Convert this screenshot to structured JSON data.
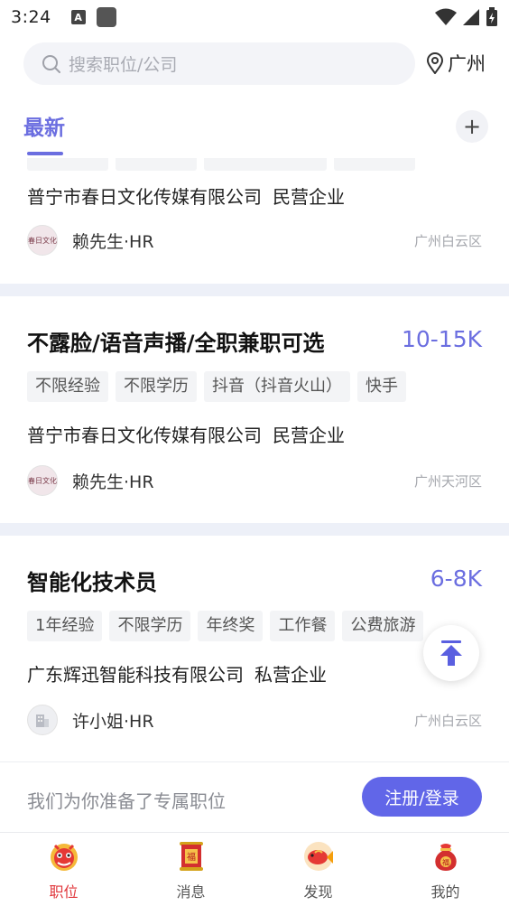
{
  "status_bar": {
    "time": "3:24",
    "a_icon_glyph": "A"
  },
  "search": {
    "placeholder": "搜索职位/公司",
    "location": "广州"
  },
  "tabs": {
    "latest": "最新"
  },
  "jobs": [
    {
      "title": "",
      "salary": "",
      "tags": [],
      "company": "普宁市春日文化传媒有限公司",
      "company_type": "民营企业",
      "hr": "赖先生·HR",
      "district": "广州白云区",
      "avatar_text": "春日文化"
    },
    {
      "title": "不露脸/语音声播/全职兼职可选",
      "salary": "10-15K",
      "tags": [
        "不限经验",
        "不限学历",
        "抖音（抖音火山）",
        "快手"
      ],
      "company": "普宁市春日文化传媒有限公司",
      "company_type": "民营企业",
      "hr": "赖先生·HR",
      "district": "广州天河区",
      "avatar_text": "春日文化"
    },
    {
      "title": "智能化技术员",
      "salary": "6-8K",
      "tags": [
        "1年经验",
        "不限学历",
        "年终奖",
        "工作餐",
        "公费旅游"
      ],
      "company": "广东辉迅智能科技有限公司",
      "company_type": "私营企业",
      "hr": "许小姐·HR",
      "district": "广州白云区",
      "avatar_text": ""
    }
  ],
  "banner": {
    "text": "我们为你准备了专属职位",
    "button": "注册/登录"
  },
  "bottom_nav": [
    {
      "label": "职位",
      "icon": "lion-dance-icon",
      "active": true
    },
    {
      "label": "消息",
      "icon": "fu-scroll-icon",
      "active": false
    },
    {
      "label": "发现",
      "icon": "koi-fish-icon",
      "active": false
    },
    {
      "label": "我的",
      "icon": "lucky-bag-icon",
      "active": false
    }
  ],
  "colors": {
    "accent": "#6b6ee0",
    "button": "#6166e8",
    "nav_active": "#e0353a"
  }
}
